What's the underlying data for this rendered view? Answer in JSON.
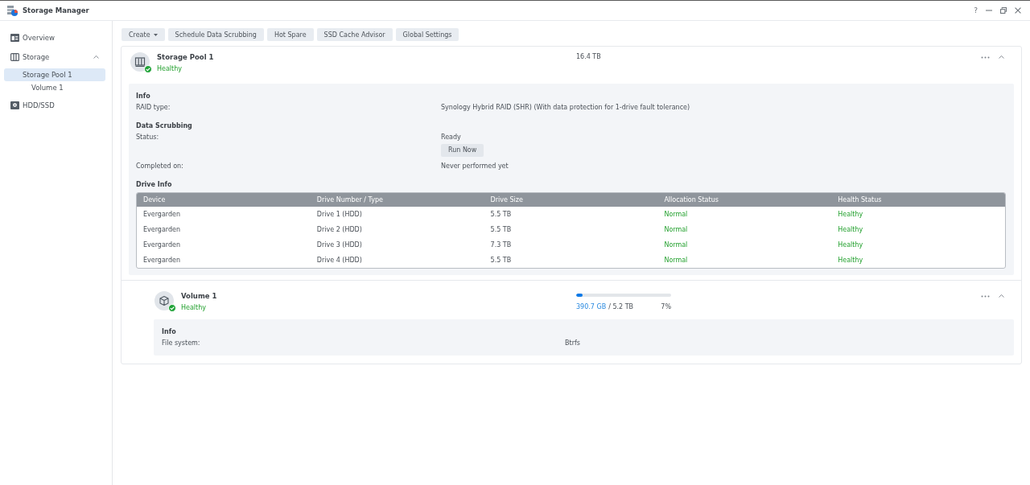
{
  "window": {
    "title": "Storage Manager",
    "help": "?"
  },
  "sidebar": {
    "items": [
      {
        "label": "Overview",
        "selected": false
      },
      {
        "label": "Storage",
        "selected": false,
        "expanded": true,
        "children": [
          {
            "label": "Storage Pool 1",
            "selected": true,
            "children": [
              {
                "label": "Volume 1",
                "selected": false
              }
            ]
          }
        ]
      },
      {
        "label": "HDD/SSD",
        "selected": false
      }
    ]
  },
  "toolbar": [
    {
      "label": "Create",
      "kind": "dropdown"
    },
    {
      "label": "Schedule Data Scrubbing",
      "kind": "button"
    },
    {
      "label": "Hot Spare",
      "kind": "button"
    },
    {
      "label": "SSD Cache Advisor",
      "kind": "button"
    },
    {
      "label": "Global Settings",
      "kind": "button"
    }
  ],
  "storage_pool": {
    "name": "Storage Pool 1",
    "status": "Healthy",
    "capacity": "16.4 TB",
    "expanded": true,
    "info": {
      "sections": [
        {
          "title": "Info",
          "rows": [
            {
              "label": "RAID type:",
              "value": "Synology Hybrid RAID (SHR) (With data protection for 1-drive fault tolerance)"
            }
          ]
        },
        {
          "title": "Data Scrubbing",
          "rows": [
            {
              "label": "Status:",
              "value": "Ready",
              "button": "Run Now"
            },
            {
              "label": "Completed on:",
              "value": "Never performed yet"
            }
          ]
        }
      ],
      "drive_info": {
        "title": "Drive Info",
        "columns": [
          {
            "label": "Device",
            "kind": "text"
          },
          {
            "label": "Drive Number / Type",
            "kind": "text"
          },
          {
            "label": "Drive Size",
            "kind": "text"
          },
          {
            "label": "Allocation Status",
            "kind": "status"
          },
          {
            "label": "Health Status",
            "kind": "status"
          }
        ],
        "rows": [
          [
            "Evergarden",
            "Drive 1 (HDD)",
            "5.5 TB",
            "Normal",
            "Healthy"
          ],
          [
            "Evergarden",
            "Drive 2 (HDD)",
            "5.5 TB",
            "Normal",
            "Healthy"
          ],
          [
            "Evergarden",
            "Drive 3 (HDD)",
            "7.3 TB",
            "Normal",
            "Healthy"
          ],
          [
            "Evergarden",
            "Drive 4 (HDD)",
            "5.5 TB",
            "Normal",
            "Healthy"
          ]
        ]
      }
    }
  },
  "volume": {
    "name": "Volume 1",
    "status": "Healthy",
    "expanded": true,
    "usage": {
      "level": 0.07,
      "used": "390.7 GB",
      "total": "/ 5.2 TB",
      "percent": "7%"
    },
    "info": {
      "sections": [
        {
          "title": "Info",
          "rows": [
            {
              "label": "File system:",
              "value": "Btrfs"
            }
          ]
        }
      ]
    }
  }
}
